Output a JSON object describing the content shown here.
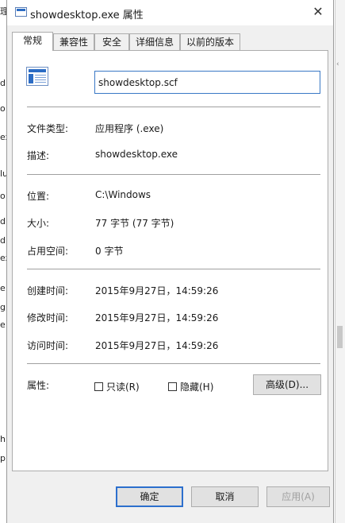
{
  "window": {
    "title": "showdesktop.exe 属性",
    "close_glyph": "✕"
  },
  "tabs": [
    "常规",
    "兼容性",
    "安全",
    "详细信息",
    "以前的版本"
  ],
  "active_tab": "常规",
  "general": {
    "file_name": "showdesktop.scf",
    "type_label": "文件类型:",
    "type_value": "应用程序 (.exe)",
    "desc_label": "描述:",
    "desc_value": "showdesktop.exe",
    "location_label": "位置:",
    "location_value": "C:\\Windows",
    "size_label": "大小:",
    "size_value": "77 字节 (77 字节)",
    "disk_label": "占用空间:",
    "disk_value": "0 字节",
    "created_label": "创建时间:",
    "created_value": "2015年9月27日，14:59:26",
    "modified_label": "修改时间:",
    "modified_value": "2015年9月27日，14:59:26",
    "accessed_label": "访问时间:",
    "accessed_value": "2015年9月27日，14:59:26",
    "attributes_label": "属性:",
    "readonly_label": "只读(R)",
    "readonly_checked": false,
    "hidden_label": "隐藏(H)",
    "hidden_checked": false,
    "advanced_label": "高级(D)..."
  },
  "footer": {
    "ok_label": "确定",
    "cancel_label": "取消",
    "apply_label": "应用(A)"
  },
  "background": {
    "fragments": [
      "理",
      "d",
      "o",
      "ex",
      "lu",
      "o",
      "d",
      "dl",
      "ex",
      "e",
      "g",
      "e",
      "h",
      "p"
    ]
  },
  "colors": {
    "accent": "#2c6fcd",
    "input_border": "#3a78c5",
    "dialog_bg": "#f0f0f0"
  }
}
